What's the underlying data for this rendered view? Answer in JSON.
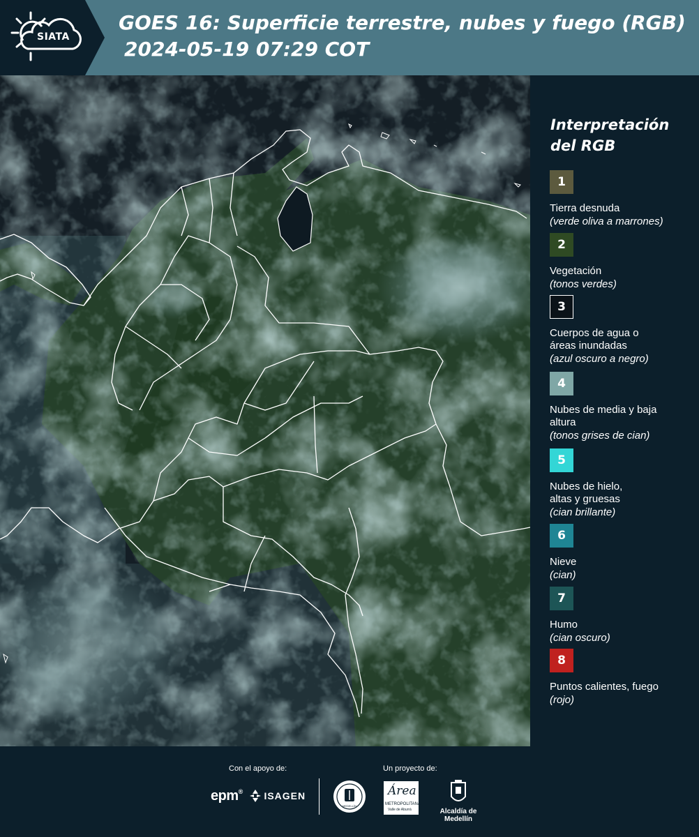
{
  "header": {
    "logo_text": "SIATA",
    "title_line1": "GOES 16: Superficie terrestre, nubes y fuego (RGB)",
    "title_line2": "2024-05-19 07:29 COT"
  },
  "legend": {
    "title_line1": "Interpretación",
    "title_line2": "del RGB",
    "items": [
      {
        "num": "1",
        "color": "#5c5a3e",
        "label": "Tierra desnuda",
        "desc": "(verde oliva a marrones)"
      },
      {
        "num": "2",
        "color": "#2f4a23",
        "label": "Vegetación",
        "desc": "(tonos verdes)"
      },
      {
        "num": "3",
        "color": "#0b1218",
        "label": "Cuerpos de agua o áreas inundadas",
        "desc": "(azul oscuro a negro)"
      },
      {
        "num": "4",
        "color": "#7fa7a6",
        "label": "Nubes de media y baja altura",
        "desc": "(tonos grises de cian)"
      },
      {
        "num": "5",
        "color": "#33d6d6",
        "label": "Nubes de hielo, altas y gruesas",
        "desc": "(cian brillante)"
      },
      {
        "num": "6",
        "color": "#1f8594",
        "label": "Nieve",
        "desc": "(cian)"
      },
      {
        "num": "7",
        "color": "#1d5556",
        "label": "Humo",
        "desc": "(cian oscuro)"
      },
      {
        "num": "8",
        "color": "#c0211f",
        "label": "Puntos calientes, fuego",
        "desc": "(rojo)"
      }
    ]
  },
  "footer": {
    "support_label": "Con el apoyo de:",
    "project_label": "Un proyecto de:",
    "epm": "epm",
    "isagen": "ISAGEN",
    "area_name": "Área",
    "area_sub": "METROPOLITANA",
    "area_sub2": "Valle de Aburrá",
    "alcaldia": "Alcaldía de Medellín",
    "seal_text": "MEDELLÍN"
  }
}
